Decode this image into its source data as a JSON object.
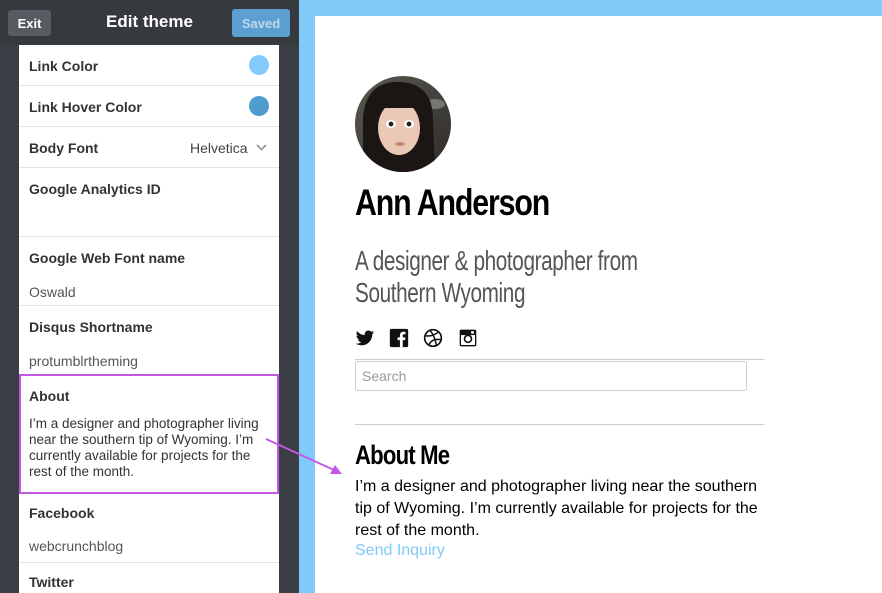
{
  "editor": {
    "exit_label": "Exit",
    "title": "Edit theme",
    "saved_label": "Saved",
    "options": {
      "link_color": {
        "label": "Link Color",
        "color": "#83cbfb"
      },
      "link_hover_color": {
        "label": "Link Hover Color",
        "color": "#4e9ccf"
      },
      "body_font": {
        "label": "Body Font",
        "value": "Helvetica"
      },
      "google_analytics": {
        "label": "Google Analytics ID",
        "value": ""
      },
      "google_web_font": {
        "label": "Google Web Font name",
        "value": "Oswald"
      },
      "disqus": {
        "label": "Disqus Shortname",
        "value": "protumblrtheming"
      },
      "about": {
        "label": "About",
        "value": "I’m a designer and photographer living near the southern tip of Wyoming. I’m currently available for projects for the rest of the month."
      },
      "facebook": {
        "label": "Facebook",
        "value": "webcrunchblog"
      },
      "twitter": {
        "label": "Twitter"
      }
    }
  },
  "preview": {
    "name": "Ann Anderson",
    "tagline": "A designer & photographer from Southern Wyoming",
    "social_icons": [
      "twitter-icon",
      "facebook-icon",
      "dribbble-icon",
      "instagram-icon"
    ],
    "search_placeholder": "Search",
    "about_heading": "About Me",
    "about_body": "I’m a designer and photographer living near the southern tip of Wyoming. I’m currently available for projects for the rest of the month.",
    "inquiry_link": "Send Inquiry"
  },
  "colors": {
    "accent": "#7fcaf9",
    "highlight": "#c158e4",
    "editor_bg": "#3b3f45"
  }
}
